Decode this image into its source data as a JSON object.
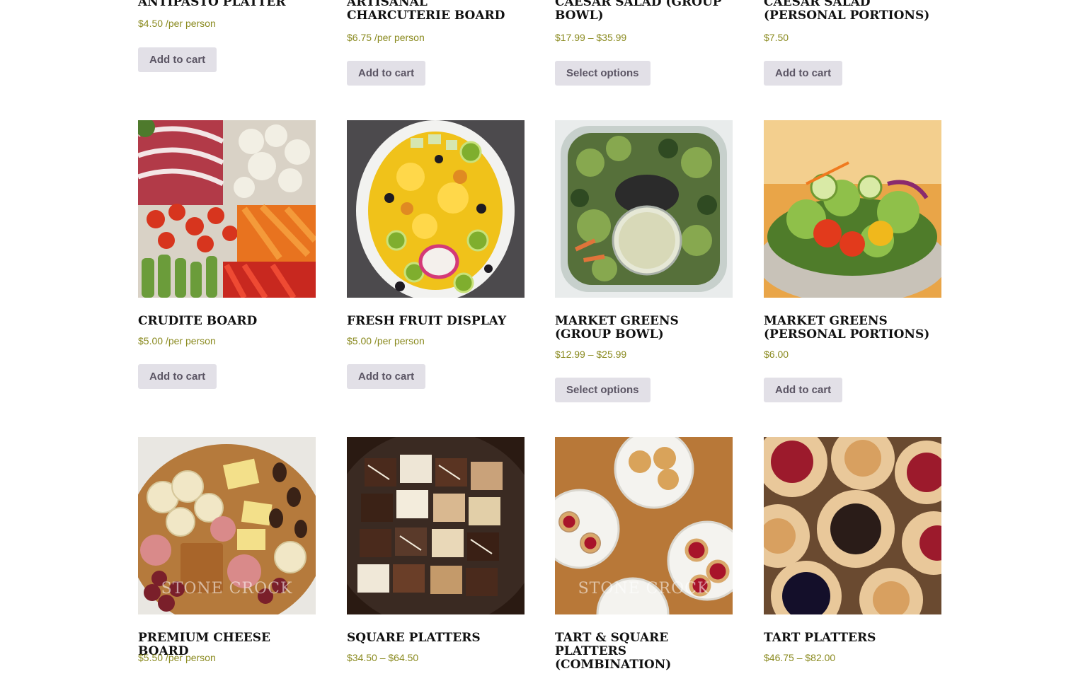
{
  "products": [
    {
      "title": "ANTIPASTO PLATTER",
      "price": "$4.50 /per person",
      "button": "Add to cart"
    },
    {
      "title": "ARTISANAL CHARCUTERIE BOARD",
      "price": "$6.75 /per person",
      "button": "Add to cart"
    },
    {
      "title": "CAESAR SALAD (GROUP BOWL)",
      "price": "$17.99 – $35.99",
      "button": "Select options"
    },
    {
      "title": "CAESAR SALAD (PERSONAL PORTIONS)",
      "price": "$7.50",
      "button": "Add to cart"
    },
    {
      "title": "CRUDITE BOARD",
      "price": "$5.00 /per person",
      "button": "Add to cart"
    },
    {
      "title": "FRESH FRUIT DISPLAY",
      "price": "$5.00 /per person",
      "button": "Add to cart"
    },
    {
      "title": "MARKET GREENS (GROUP BOWL)",
      "price": "$12.99 – $25.99",
      "button": "Select options"
    },
    {
      "title": "MARKET GREENS (PERSONAL PORTIONS)",
      "price": "$6.00",
      "button": "Add to cart"
    },
    {
      "title": "PREMIUM CHEESE BOARD",
      "price": "$5.50 /per person",
      "watermark": "STONE CROCK"
    },
    {
      "title": "SQUARE PLATTERS",
      "price": "$34.50 – $64.50"
    },
    {
      "title": "TART & SQUARE PLATTERS (COMBINATION)",
      "price": "",
      "watermark": "STONE CROCK"
    },
    {
      "title": "TART PLATTERS",
      "price": "$46.75 – $82.00"
    }
  ],
  "colors": {
    "price": "#8a8a1f",
    "button_bg": "#e2e0e7",
    "button_text": "#5b5564",
    "title": "#111111"
  }
}
